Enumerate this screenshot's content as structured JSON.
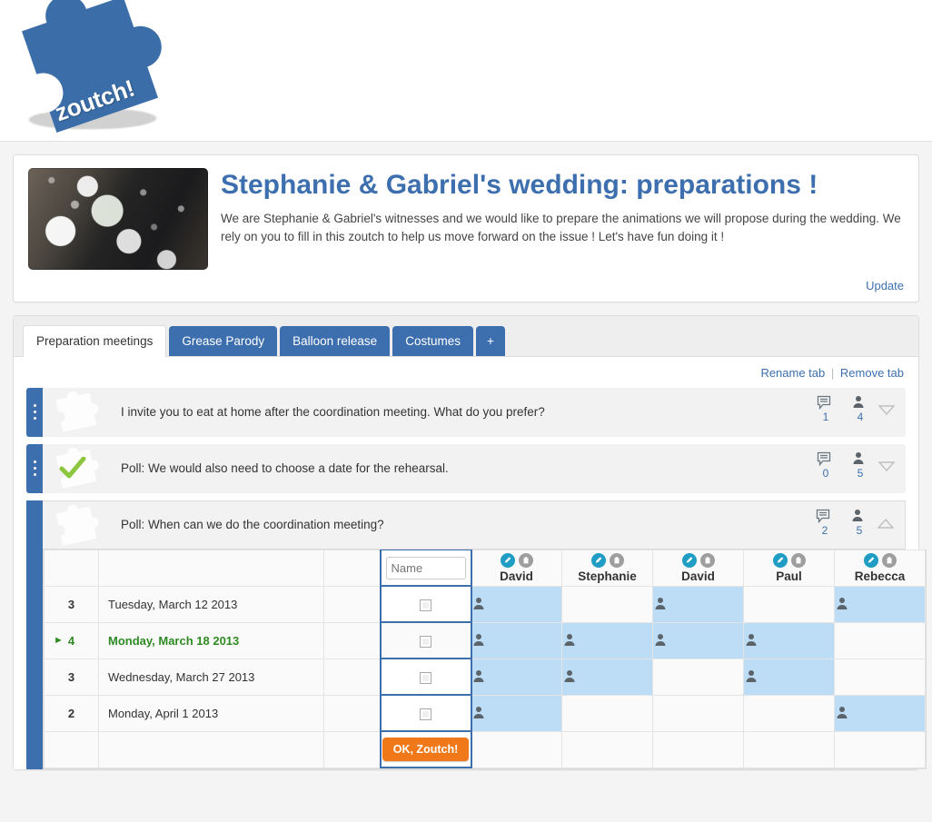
{
  "brand": {
    "logo_text": "zoutch!",
    "logo_color": "#3b6ea8"
  },
  "project": {
    "title": "Stephanie & Gabriel's wedding: preparations !",
    "description": "We are Stephanie & Gabriel's witnesses and we would like to prepare the animations we will propose during the wedding. We rely on you to fill in this zoutch to help us move forward on the issue ! Let's have fun doing it !",
    "update_link": "Update",
    "photo_alt": "wedding-confetti-photo"
  },
  "tabs": {
    "items": [
      {
        "label": "Preparation meetings",
        "active": true
      },
      {
        "label": "Grease Parody",
        "active": false
      },
      {
        "label": "Balloon release",
        "active": false
      },
      {
        "label": "Costumes",
        "active": false
      },
      {
        "label": "+",
        "active": false
      }
    ],
    "rename_label": "Rename tab",
    "remove_label": "Remove tab",
    "separator": "|"
  },
  "polls": [
    {
      "title": "I invite you to eat at home after the coordination meeting. What do you prefer?",
      "comments": "1",
      "participants": "4",
      "expanded": false,
      "answered": false
    },
    {
      "title": "Poll: We would also need to choose a date for the rehearsal.",
      "comments": "0",
      "participants": "5",
      "expanded": false,
      "answered": true
    },
    {
      "title": "Poll: When can we do the coordination meeting?",
      "comments": "2",
      "participants": "5",
      "expanded": true,
      "answered": false
    }
  ],
  "poll_table": {
    "my_vote_placeholder": "Name",
    "my_vote_value": "",
    "submit_label": "OK, Zoutch!",
    "participants": [
      {
        "name": "David"
      },
      {
        "name": "Stephanie"
      },
      {
        "name": "David"
      },
      {
        "name": "Paul"
      },
      {
        "name": "Rebecca"
      }
    ],
    "rows": [
      {
        "count": "3",
        "date": "Tuesday, March 12 2013",
        "winner": false,
        "votes": [
          true,
          false,
          true,
          false,
          true
        ]
      },
      {
        "count": "4",
        "date": "Monday, March 18 2013",
        "winner": true,
        "votes": [
          true,
          true,
          true,
          true,
          false
        ]
      },
      {
        "count": "3",
        "date": "Wednesday, March 27 2013",
        "winner": false,
        "votes": [
          true,
          true,
          false,
          true,
          false
        ]
      },
      {
        "count": "2",
        "date": "Monday, April 1 2013",
        "winner": false,
        "votes": [
          true,
          false,
          false,
          false,
          true
        ]
      }
    ]
  },
  "colors": {
    "brand_blue": "#3d6fae",
    "vote_blue": "#bdddf7",
    "winner_green": "#2e8b22",
    "submit_orange": "#f07818",
    "edit_icon": "#1f9dc4",
    "delete_icon": "#9e9e9e"
  }
}
